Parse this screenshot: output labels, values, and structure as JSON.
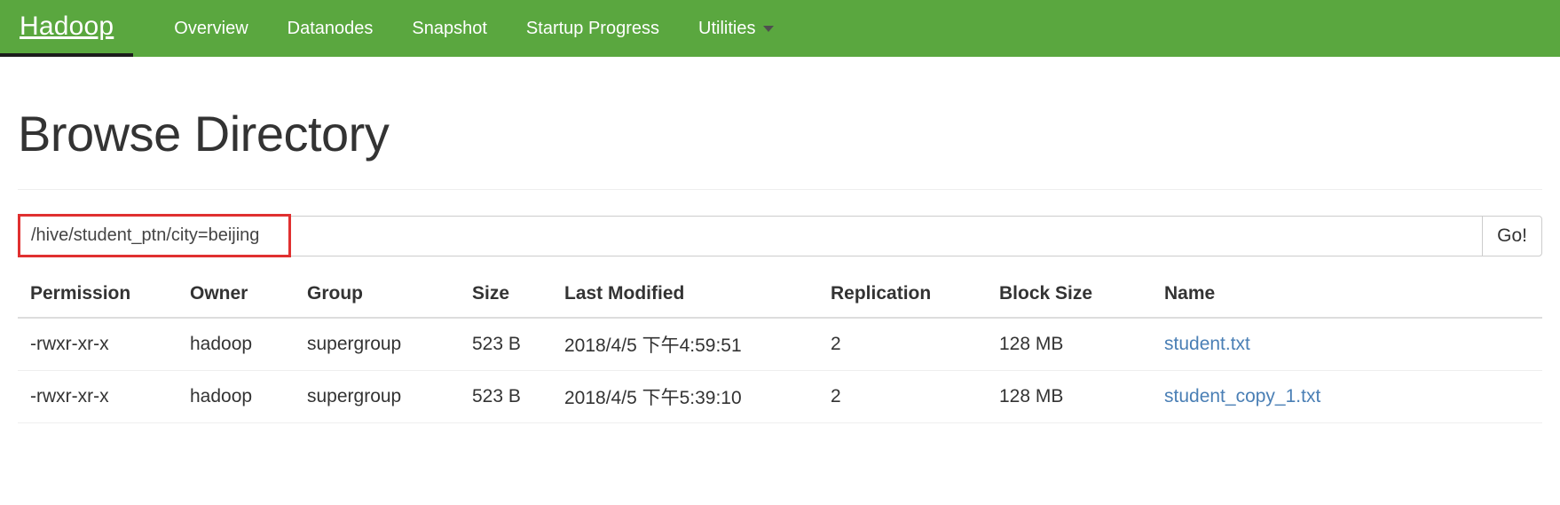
{
  "navbar": {
    "brand": "Hadoop",
    "brand_color": "#5aa73f",
    "items": [
      {
        "label": "Overview",
        "has_caret": false
      },
      {
        "label": "Datanodes",
        "has_caret": false
      },
      {
        "label": "Snapshot",
        "has_caret": false
      },
      {
        "label": "Startup Progress",
        "has_caret": false
      },
      {
        "label": "Utilities",
        "has_caret": true
      }
    ]
  },
  "page": {
    "title": "Browse Directory"
  },
  "path_bar": {
    "value": "/hive/student_ptn/city=beijing",
    "placeholder": "",
    "go_label": "Go!",
    "highlight_color": "#e03030"
  },
  "table": {
    "headers": [
      "Permission",
      "Owner",
      "Group",
      "Size",
      "Last Modified",
      "Replication",
      "Block Size",
      "Name"
    ],
    "rows": [
      {
        "permission": "-rwxr-xr-x",
        "owner": "hadoop",
        "group": "supergroup",
        "size": "523 B",
        "last_modified": "2018/4/5 下午4:59:51",
        "replication": "2",
        "block_size": "128 MB",
        "name": "student.txt"
      },
      {
        "permission": "-rwxr-xr-x",
        "owner": "hadoop",
        "group": "supergroup",
        "size": "523 B",
        "last_modified": "2018/4/5 下午5:39:10",
        "replication": "2",
        "block_size": "128 MB",
        "name": "student_copy_1.txt"
      }
    ],
    "link_color": "#4a7fb5"
  }
}
